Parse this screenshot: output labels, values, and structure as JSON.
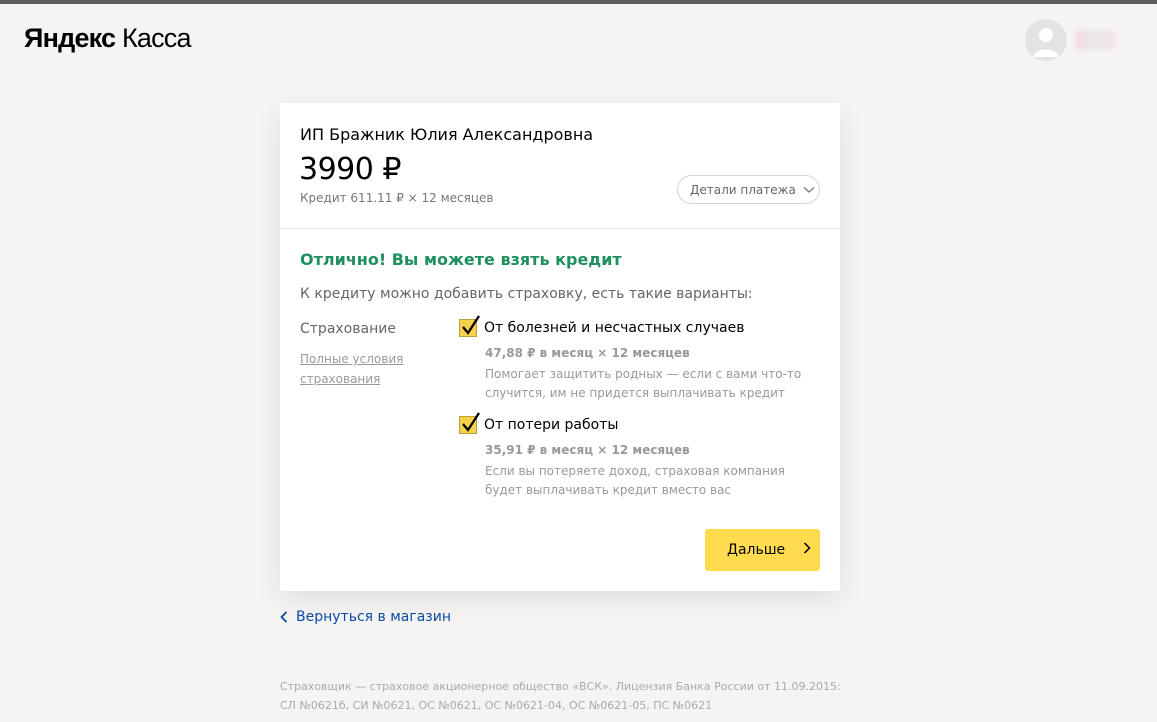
{
  "header": {
    "logo_bold": "Яндекс",
    "logo_regular": "Касса",
    "avatar_icon": "user-avatar-icon"
  },
  "payment": {
    "merchant": "ИП Бражник Юлия Александровна",
    "amount": "3990 ₽",
    "credit_info": "Кредит 611.11 ₽ × 12 месяцев",
    "details_label": "Детали платежа",
    "details_icon": "chevron-down-icon"
  },
  "offer": {
    "success_title": "Отлично! Вы можете взять кредит",
    "subtitle": "К кредиту можно добавить страховку, есть такие варианты:",
    "insurance_label": "Страхование",
    "terms_link": "Полные условия страхования"
  },
  "options": [
    {
      "title": "От болезней и несчастных случаев",
      "price": "47,88 ₽ в месяц × 12 месяцев",
      "description": "Помогает защитить родных — если с вами что-то случится, им не придется выплачивать кредит",
      "checked": true
    },
    {
      "title": "От потери работы",
      "price": "35,91 ₽ в месяц × 12 месяцев",
      "description": "Если вы потеряете доход, страховая компания будет выплачивать кредит вместо вас",
      "checked": true
    }
  ],
  "actions": {
    "next_label": "Дальше",
    "back_label": "Вернуться в магазин"
  },
  "footer": {
    "text": "Страховщик — страховое акционерное общество «ВСК». Лицензия Банка России от 11.09.2015: СЛ №0621б, СИ №0621, ОС №0621, ОС №0621-04, ОС №0621-05, ПС №0621"
  },
  "colors": {
    "accent_yellow": "#ffdb4d",
    "success_green": "#1f8f5d",
    "link_blue": "#0c4aa6",
    "background": "#f5f4f2"
  }
}
